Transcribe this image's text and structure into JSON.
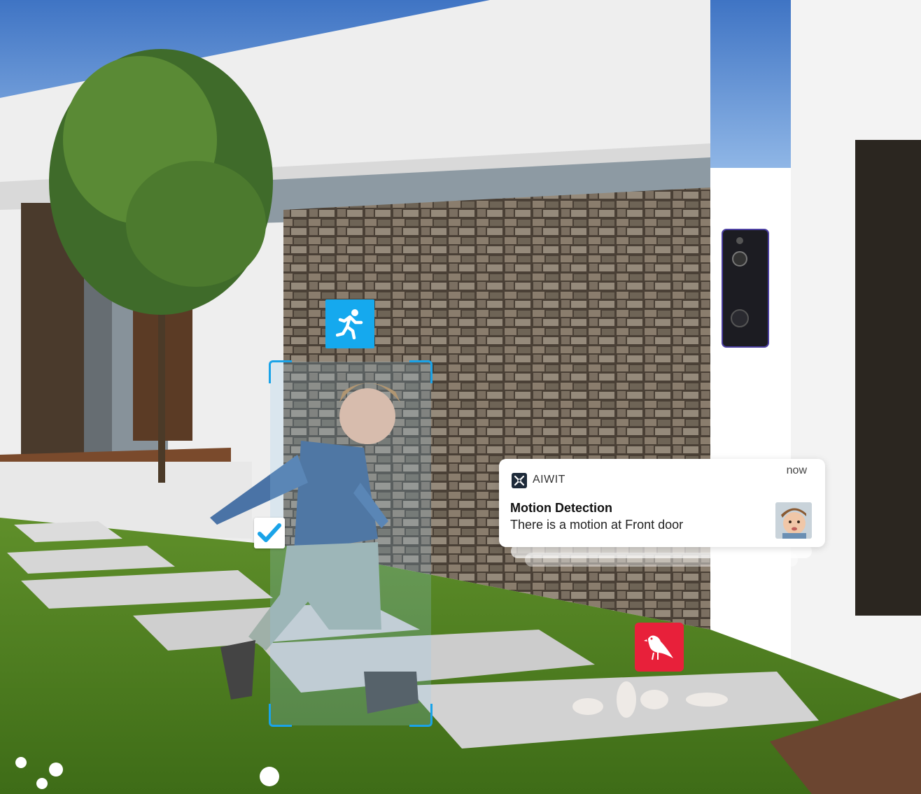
{
  "notification": {
    "app_name": "AIWIT",
    "time": "now",
    "title": "Motion Detection",
    "body": "There is a motion at Front door",
    "app_icon": "aiwit-logo-icon",
    "thumbnail": "child-avatar"
  },
  "badges": {
    "person_motion": {
      "icon": "running-person-icon",
      "color": "#15a9ee"
    },
    "animal_motion": {
      "icon": "bird-icon",
      "color": "#e8203a"
    },
    "confirmed": {
      "icon": "checkmark-icon",
      "color": "#1aa3e8"
    }
  },
  "device": {
    "name": "video-doorbell"
  }
}
